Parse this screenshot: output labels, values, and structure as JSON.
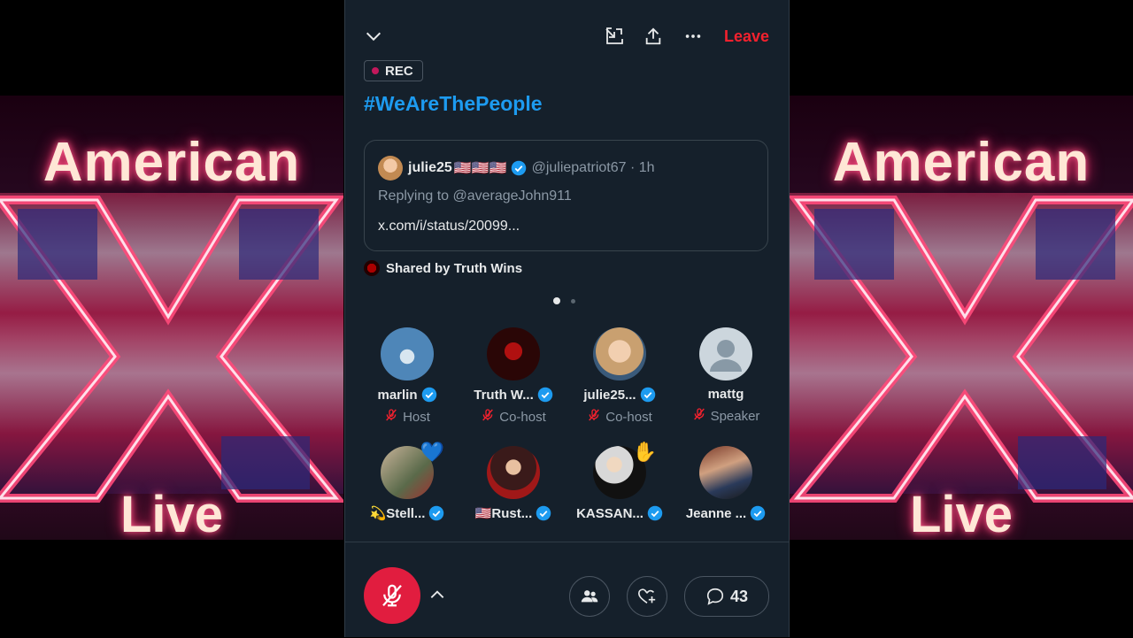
{
  "banner": {
    "title": "American",
    "live": "Live"
  },
  "header": {
    "leave_label": "Leave"
  },
  "rec_label": "REC",
  "space_title": "#WeAreThePeople",
  "tweet": {
    "name": "julie25",
    "flags": "🇺🇸🇺🇸🇺🇸",
    "handle": "@juliepatriot67 · 1h",
    "reply": "Replying to @averageJohn911",
    "link": "x.com/i/status/20099..."
  },
  "shared_by": "Shared by Truth Wins",
  "participants": [
    {
      "name": "marlin",
      "role": "Host"
    },
    {
      "name": "Truth W...",
      "role": "Co-host"
    },
    {
      "name": "julie25...",
      "role": "Co-host"
    },
    {
      "name": "mattg",
      "role": "Speaker"
    },
    {
      "name": "💫Stell...",
      "reaction": "💙"
    },
    {
      "name": "🇺🇸Rust..."
    },
    {
      "name": "KASSAN...",
      "reaction": "✋"
    },
    {
      "name": "Jeanne ..."
    }
  ],
  "comment_count": "43",
  "colors": {
    "accent": "#1d9bf0",
    "leave": "#f4212e",
    "mic": "#e11d3f",
    "panel_bg": "#15202b"
  },
  "icons": [
    "chevron-down-icon",
    "minimize-icon",
    "share-icon",
    "more-icon",
    "mic-off-icon",
    "chevron-up-icon",
    "people-icon",
    "heart-plus-icon",
    "comment-icon",
    "verified-icon"
  ]
}
